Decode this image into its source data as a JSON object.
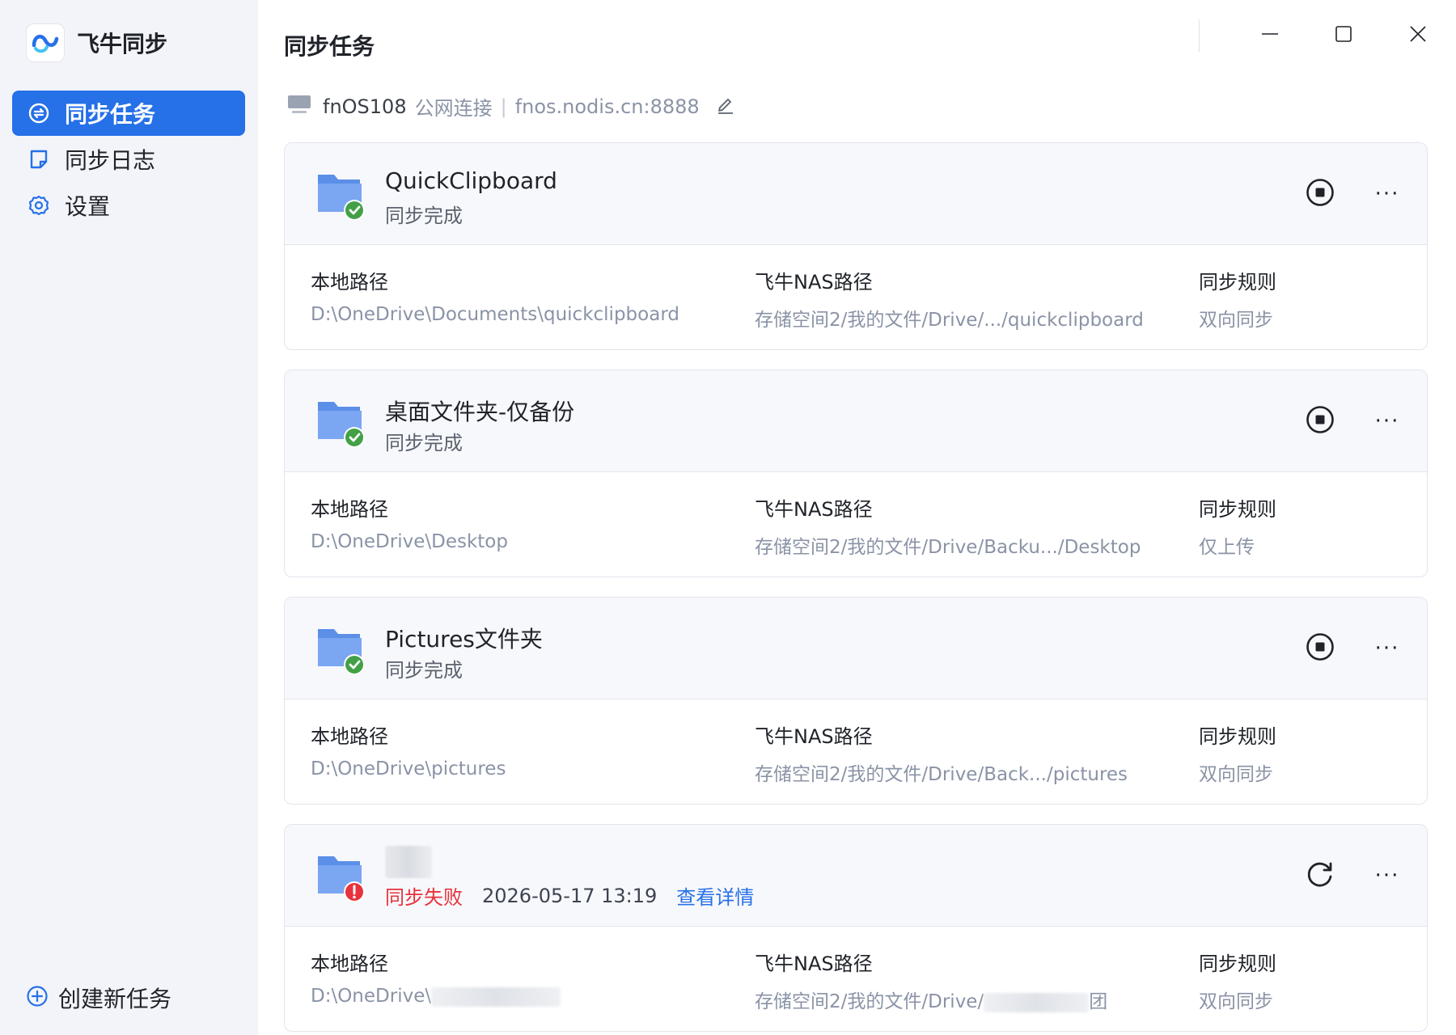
{
  "app": {
    "name": "飞牛同步",
    "accent": "#2670e8",
    "logo_icon": "fn-sync-logo-icon"
  },
  "sidebar": {
    "items": [
      {
        "label": "同步任务",
        "icon": "sync-circle-icon",
        "active": true
      },
      {
        "label": "同步日志",
        "icon": "log-note-icon",
        "active": false
      },
      {
        "label": "设置",
        "icon": "gear-icon",
        "active": false
      }
    ],
    "create_label": "创建新任务"
  },
  "header": {
    "title": "同步任务"
  },
  "connection": {
    "device": "fnOS108",
    "type": "公网连接",
    "separator": "|",
    "address": "fnos.nodis.cn:8888"
  },
  "columns": {
    "local": "本地路径",
    "nas": "飞牛NAS路径",
    "rule": "同步规则"
  },
  "tasks": [
    {
      "name": "QuickClipboard",
      "status": "同步完成",
      "state": "success",
      "local_path": "D:\\OneDrive\\Documents\\quickclipboard",
      "nas_path": "存储空间2/我的文件/Drive/.../quickclipboard",
      "rule": "双向同步"
    },
    {
      "name": "桌面文件夹-仅备份",
      "status": "同步完成",
      "state": "success",
      "local_path": "D:\\OneDrive\\Desktop",
      "nas_path": "存储空间2/我的文件/Drive/Backu.../Desktop",
      "rule": "仅上传"
    },
    {
      "name": "Pictures文件夹",
      "status": "同步完成",
      "state": "success",
      "local_path": "D:\\OneDrive\\pictures",
      "nas_path": "存储空间2/我的文件/Drive/Back.../pictures",
      "rule": "双向同步"
    },
    {
      "name": "",
      "status": "同步失败",
      "state": "error",
      "time": "2026-05-17 13:19",
      "detail_link": "查看详情",
      "local_path": "D:\\OneDrive\\",
      "nas_path": "存储空间2/我的文件/Drive/",
      "nas_path_tail": "团",
      "rule": "双向同步"
    }
  ],
  "colors": {
    "success": "#43a047",
    "error": "#e8323c",
    "folder": "#6f9ff0",
    "muted": "#8a93a6"
  }
}
